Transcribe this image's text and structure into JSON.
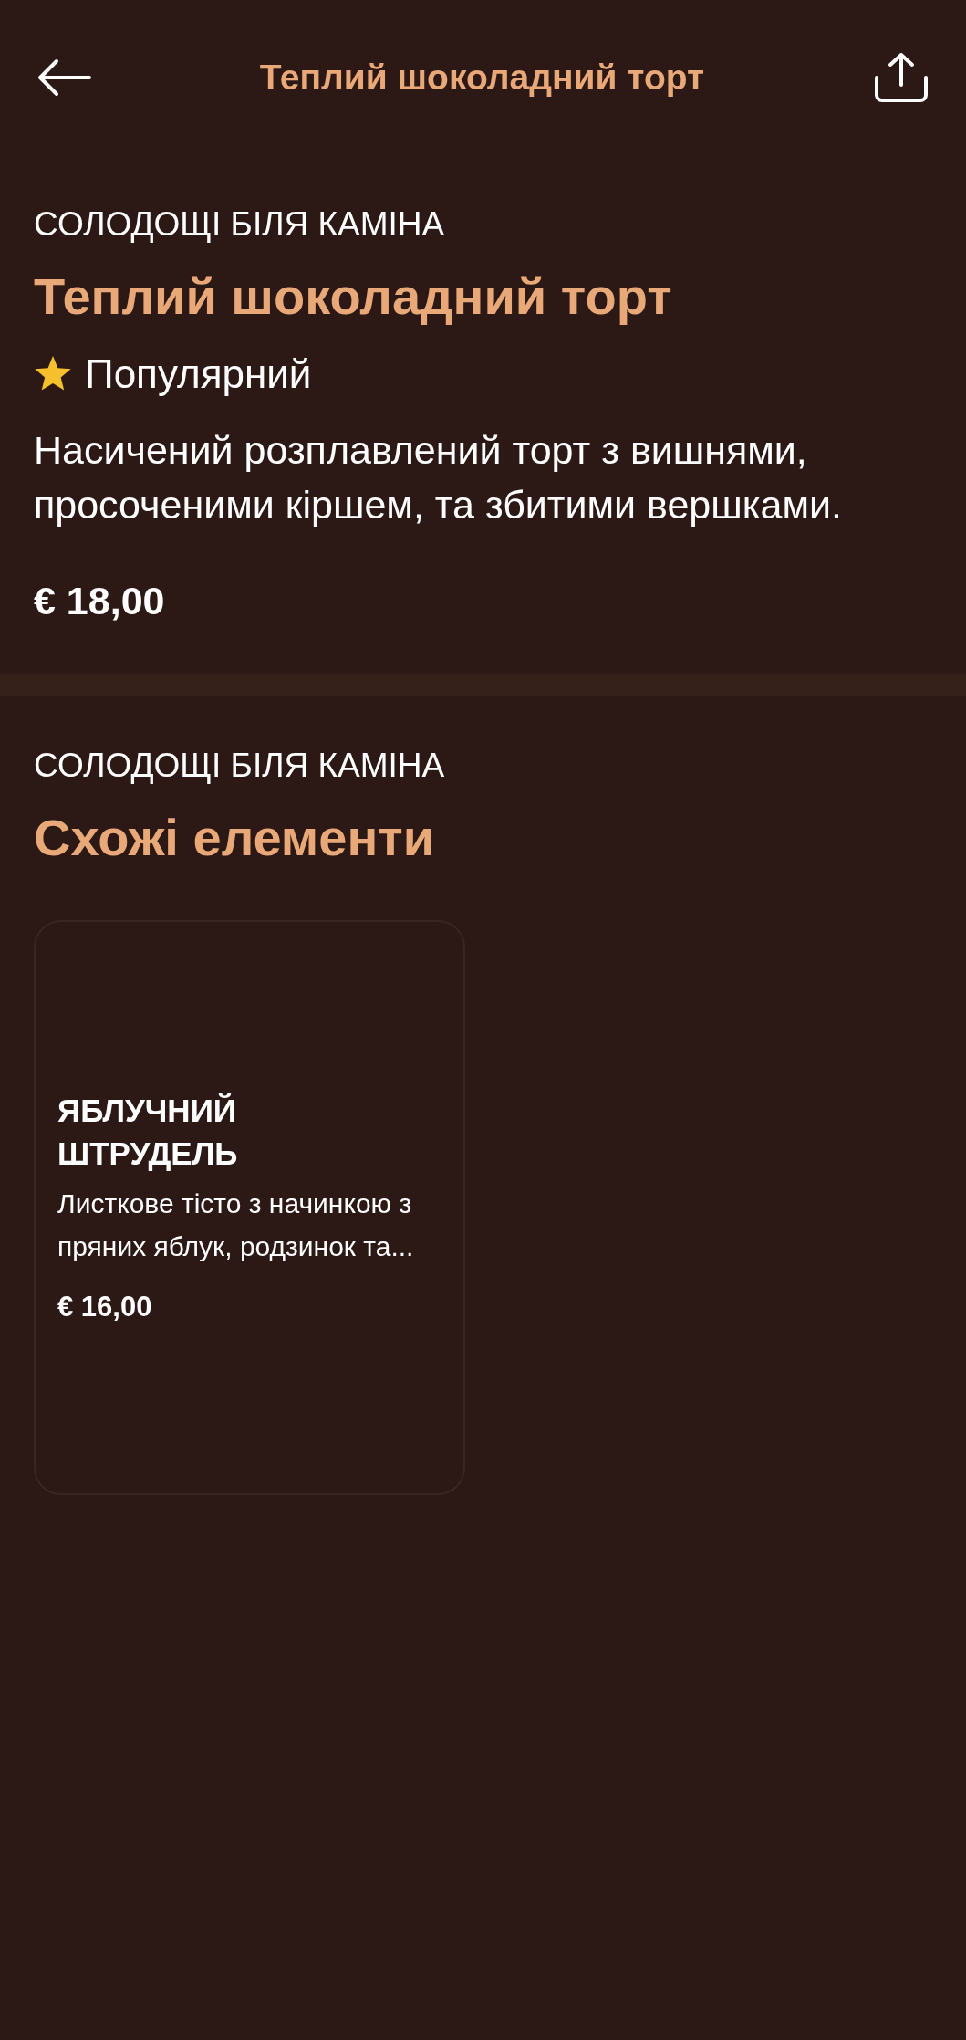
{
  "header": {
    "title": "Теплий шоколадний торт"
  },
  "item": {
    "category": "СОЛОДОЩІ БІЛЯ КАМІНА",
    "name": "Теплий шоколадний торт",
    "badge": "Популярний",
    "description": "Насичений розплавлений торт з вишнями, просоченими кіршем, та збитими вершками.",
    "price": "€ 18,00"
  },
  "related": {
    "category": "СОЛОДОЩІ БІЛЯ КАМІНА",
    "title": "Схожі елементи",
    "items": [
      {
        "name": "ЯБЛУЧНИЙ ШТРУДЕЛЬ",
        "description": "Листкове тісто з начинкою з пряних яблук, родзинок та...",
        "price": "€ 16,00"
      }
    ]
  }
}
